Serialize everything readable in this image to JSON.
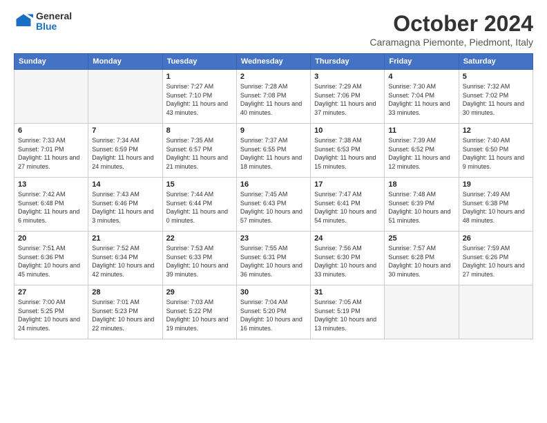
{
  "header": {
    "logo": {
      "general": "General",
      "blue": "Blue"
    },
    "title": "October 2024",
    "subtitle": "Caramagna Piemonte, Piedmont, Italy"
  },
  "weekdays": [
    "Sunday",
    "Monday",
    "Tuesday",
    "Wednesday",
    "Thursday",
    "Friday",
    "Saturday"
  ],
  "weeks": [
    [
      {
        "day": "",
        "empty": true
      },
      {
        "day": "",
        "empty": true
      },
      {
        "day": "1",
        "sunrise": "Sunrise: 7:27 AM",
        "sunset": "Sunset: 7:10 PM",
        "daylight": "Daylight: 11 hours and 43 minutes."
      },
      {
        "day": "2",
        "sunrise": "Sunrise: 7:28 AM",
        "sunset": "Sunset: 7:08 PM",
        "daylight": "Daylight: 11 hours and 40 minutes."
      },
      {
        "day": "3",
        "sunrise": "Sunrise: 7:29 AM",
        "sunset": "Sunset: 7:06 PM",
        "daylight": "Daylight: 11 hours and 37 minutes."
      },
      {
        "day": "4",
        "sunrise": "Sunrise: 7:30 AM",
        "sunset": "Sunset: 7:04 PM",
        "daylight": "Daylight: 11 hours and 33 minutes."
      },
      {
        "day": "5",
        "sunrise": "Sunrise: 7:32 AM",
        "sunset": "Sunset: 7:02 PM",
        "daylight": "Daylight: 11 hours and 30 minutes."
      }
    ],
    [
      {
        "day": "6",
        "sunrise": "Sunrise: 7:33 AM",
        "sunset": "Sunset: 7:01 PM",
        "daylight": "Daylight: 11 hours and 27 minutes."
      },
      {
        "day": "7",
        "sunrise": "Sunrise: 7:34 AM",
        "sunset": "Sunset: 6:59 PM",
        "daylight": "Daylight: 11 hours and 24 minutes."
      },
      {
        "day": "8",
        "sunrise": "Sunrise: 7:35 AM",
        "sunset": "Sunset: 6:57 PM",
        "daylight": "Daylight: 11 hours and 21 minutes."
      },
      {
        "day": "9",
        "sunrise": "Sunrise: 7:37 AM",
        "sunset": "Sunset: 6:55 PM",
        "daylight": "Daylight: 11 hours and 18 minutes."
      },
      {
        "day": "10",
        "sunrise": "Sunrise: 7:38 AM",
        "sunset": "Sunset: 6:53 PM",
        "daylight": "Daylight: 11 hours and 15 minutes."
      },
      {
        "day": "11",
        "sunrise": "Sunrise: 7:39 AM",
        "sunset": "Sunset: 6:52 PM",
        "daylight": "Daylight: 11 hours and 12 minutes."
      },
      {
        "day": "12",
        "sunrise": "Sunrise: 7:40 AM",
        "sunset": "Sunset: 6:50 PM",
        "daylight": "Daylight: 11 hours and 9 minutes."
      }
    ],
    [
      {
        "day": "13",
        "sunrise": "Sunrise: 7:42 AM",
        "sunset": "Sunset: 6:48 PM",
        "daylight": "Daylight: 11 hours and 6 minutes."
      },
      {
        "day": "14",
        "sunrise": "Sunrise: 7:43 AM",
        "sunset": "Sunset: 6:46 PM",
        "daylight": "Daylight: 11 hours and 3 minutes."
      },
      {
        "day": "15",
        "sunrise": "Sunrise: 7:44 AM",
        "sunset": "Sunset: 6:44 PM",
        "daylight": "Daylight: 11 hours and 0 minutes."
      },
      {
        "day": "16",
        "sunrise": "Sunrise: 7:45 AM",
        "sunset": "Sunset: 6:43 PM",
        "daylight": "Daylight: 10 hours and 57 minutes."
      },
      {
        "day": "17",
        "sunrise": "Sunrise: 7:47 AM",
        "sunset": "Sunset: 6:41 PM",
        "daylight": "Daylight: 10 hours and 54 minutes."
      },
      {
        "day": "18",
        "sunrise": "Sunrise: 7:48 AM",
        "sunset": "Sunset: 6:39 PM",
        "daylight": "Daylight: 10 hours and 51 minutes."
      },
      {
        "day": "19",
        "sunrise": "Sunrise: 7:49 AM",
        "sunset": "Sunset: 6:38 PM",
        "daylight": "Daylight: 10 hours and 48 minutes."
      }
    ],
    [
      {
        "day": "20",
        "sunrise": "Sunrise: 7:51 AM",
        "sunset": "Sunset: 6:36 PM",
        "daylight": "Daylight: 10 hours and 45 minutes."
      },
      {
        "day": "21",
        "sunrise": "Sunrise: 7:52 AM",
        "sunset": "Sunset: 6:34 PM",
        "daylight": "Daylight: 10 hours and 42 minutes."
      },
      {
        "day": "22",
        "sunrise": "Sunrise: 7:53 AM",
        "sunset": "Sunset: 6:33 PM",
        "daylight": "Daylight: 10 hours and 39 minutes."
      },
      {
        "day": "23",
        "sunrise": "Sunrise: 7:55 AM",
        "sunset": "Sunset: 6:31 PM",
        "daylight": "Daylight: 10 hours and 36 minutes."
      },
      {
        "day": "24",
        "sunrise": "Sunrise: 7:56 AM",
        "sunset": "Sunset: 6:30 PM",
        "daylight": "Daylight: 10 hours and 33 minutes."
      },
      {
        "day": "25",
        "sunrise": "Sunrise: 7:57 AM",
        "sunset": "Sunset: 6:28 PM",
        "daylight": "Daylight: 10 hours and 30 minutes."
      },
      {
        "day": "26",
        "sunrise": "Sunrise: 7:59 AM",
        "sunset": "Sunset: 6:26 PM",
        "daylight": "Daylight: 10 hours and 27 minutes."
      }
    ],
    [
      {
        "day": "27",
        "sunrise": "Sunrise: 7:00 AM",
        "sunset": "Sunset: 5:25 PM",
        "daylight": "Daylight: 10 hours and 24 minutes."
      },
      {
        "day": "28",
        "sunrise": "Sunrise: 7:01 AM",
        "sunset": "Sunset: 5:23 PM",
        "daylight": "Daylight: 10 hours and 22 minutes."
      },
      {
        "day": "29",
        "sunrise": "Sunrise: 7:03 AM",
        "sunset": "Sunset: 5:22 PM",
        "daylight": "Daylight: 10 hours and 19 minutes."
      },
      {
        "day": "30",
        "sunrise": "Sunrise: 7:04 AM",
        "sunset": "Sunset: 5:20 PM",
        "daylight": "Daylight: 10 hours and 16 minutes."
      },
      {
        "day": "31",
        "sunrise": "Sunrise: 7:05 AM",
        "sunset": "Sunset: 5:19 PM",
        "daylight": "Daylight: 10 hours and 13 minutes."
      },
      {
        "day": "",
        "empty": true
      },
      {
        "day": "",
        "empty": true
      }
    ]
  ]
}
